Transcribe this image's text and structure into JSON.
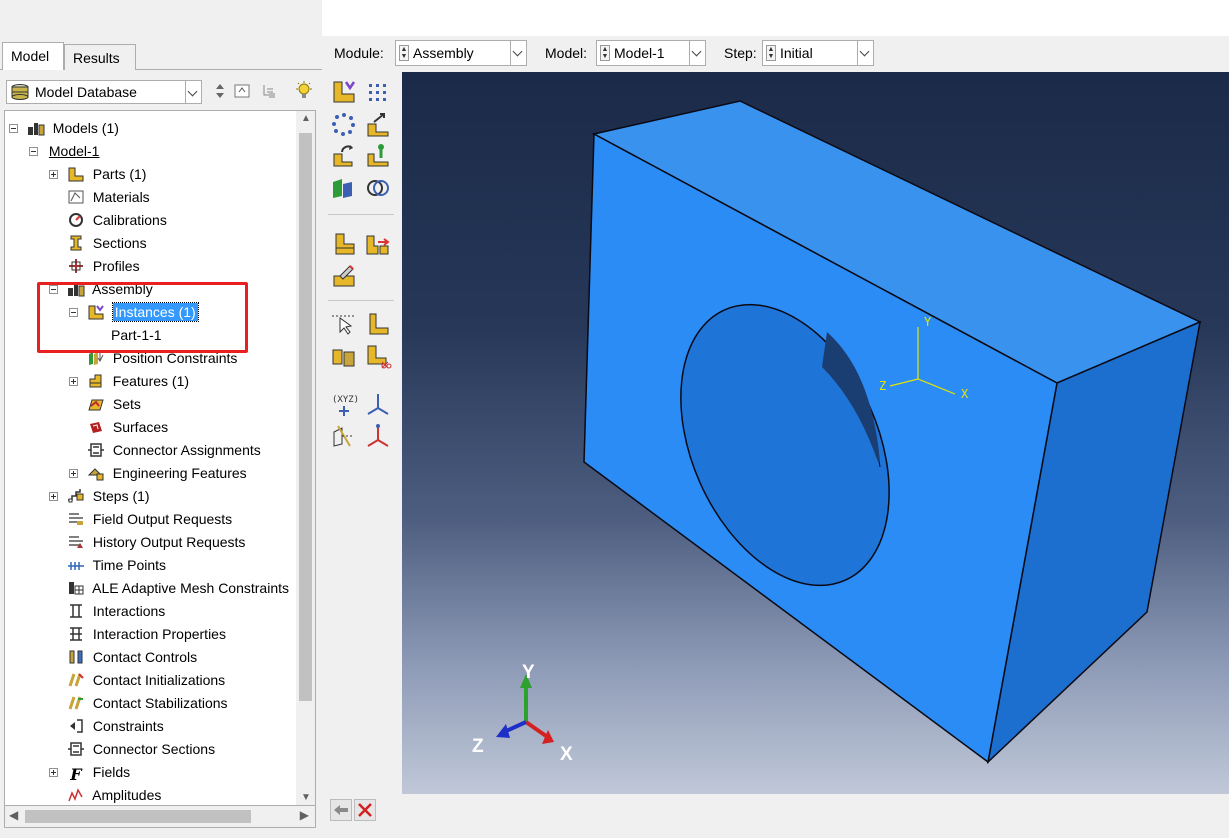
{
  "left_panel": {
    "tabs": [
      {
        "label": "Model",
        "active": true
      },
      {
        "label": "Results",
        "active": false
      }
    ],
    "database_selector": {
      "value": "Model Database"
    },
    "tree": {
      "models": "Models (1)",
      "model_1": "Model-1",
      "parts": "Parts (1)",
      "materials": "Materials",
      "calibrations": "Calibrations",
      "sections": "Sections",
      "profiles": "Profiles",
      "assembly": "Assembly",
      "instances": "Instances (1)",
      "part_1_1": "Part-1-1",
      "position_constraints": "Position Constraints",
      "features": "Features (1)",
      "sets": "Sets",
      "surfaces": "Surfaces",
      "connector_assignments": "Connector Assignments",
      "engineering_features": "Engineering Features",
      "steps": "Steps (1)",
      "field_output_requests": "Field Output Requests",
      "history_output_requests": "History Output Requests",
      "time_points": "Time Points",
      "ale_adaptive_mesh": "ALE Adaptive Mesh Constraints",
      "interactions": "Interactions",
      "interaction_properties": "Interaction Properties",
      "contact_controls": "Contact Controls",
      "contact_initializations": "Contact Initializations",
      "contact_stabilizations": "Contact Stabilizations",
      "constraints": "Constraints",
      "connector_sections": "Connector Sections",
      "fields": "Fields",
      "amplitudes": "Amplitudes"
    }
  },
  "context_bar": {
    "module_label": "Module:",
    "module_value": "Assembly",
    "model_label": "Model:",
    "model_value": "Model-1",
    "step_label": "Step:",
    "step_value": "Initial"
  },
  "viewport": {
    "csys_labels": {
      "y": "Y",
      "x": "X",
      "z": "Z"
    },
    "triad_labels": {
      "y": "Y",
      "x": "X",
      "z": "Z"
    }
  },
  "colors": {
    "part_front": "#2b8cf5",
    "part_top": "#3a92ef",
    "part_side": "#1c6fcf",
    "highlight_box": "#e82020",
    "selection": "#3399ff"
  }
}
